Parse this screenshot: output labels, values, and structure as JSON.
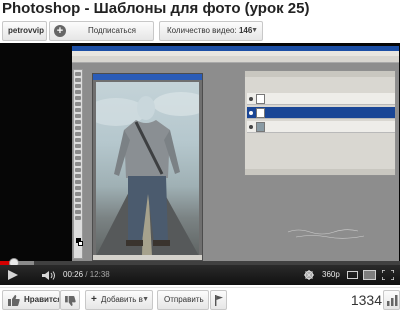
{
  "video": {
    "title": "Photoshop - Шаблоны для фото (урок 25)"
  },
  "channel": {
    "name": "petrovvip",
    "subscribe_label": "Подписаться",
    "videos_label": "Количество видео:",
    "videos_count": "146"
  },
  "player": {
    "current_time": "00:26",
    "duration": "12:38",
    "progress": 0.034,
    "loaded": 0.085,
    "quality": "360p"
  },
  "actions": {
    "like_label": "Нравится",
    "add_label": "Добавить в",
    "send_label": "Отправить",
    "views": "1334"
  },
  "icons": {
    "play": "play-icon",
    "volume": "volume-icon",
    "hd": "hd-icon",
    "fullscreen": "fullscreen-icon",
    "like": "thumbs-up-icon",
    "dislike": "thumbs-down-icon",
    "flag": "flag-icon",
    "stats": "stats-icon"
  },
  "colors": {
    "accent": "#d30000",
    "selection": "#1a4696"
  }
}
